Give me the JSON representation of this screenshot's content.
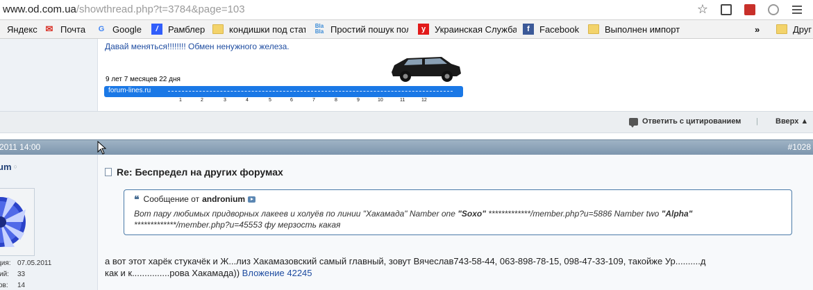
{
  "browser": {
    "url_host": "www.od.com.ua",
    "url_path": "/showthread.php?t=3784&page=103"
  },
  "bookmarks": [
    {
      "label": "Яндекс",
      "icon": "yandex-icon"
    },
    {
      "label": "Почта",
      "icon": "gmail-icon"
    },
    {
      "label": "Google",
      "icon": "google-icon"
    },
    {
      "label": "Рамблер",
      "icon": "rambler-icon"
    },
    {
      "label": "кондишки под стать",
      "icon": "folder-icon"
    },
    {
      "label": "Простий пошук пол",
      "icon": "blabla-icon"
    },
    {
      "label": "Украинская Служба",
      "icon": "y-icon"
    },
    {
      "label": "Facebook",
      "icon": "facebook-icon"
    },
    {
      "label": "Выполнен импорт",
      "icon": "folder-icon"
    },
    {
      "label": "»",
      "icon": "overflow-icon"
    },
    {
      "label": "Друг",
      "icon": "folder-icon"
    }
  ],
  "prev_post": {
    "signature_link": "Давай меняться!!!!!!!! Обмен ненужного железа.",
    "banner_age": "9 лет 7 месяцев 22 дня",
    "banner_label": "forum-lines.ru",
    "banner_scale": [
      "1",
      "2",
      "3",
      "4",
      "5",
      "6",
      "7",
      "8",
      "9",
      "10",
      "11",
      "12"
    ],
    "reply_quote": "Ответить с цитированием",
    "separator": "|",
    "top_link": "Вверх ▲"
  },
  "post": {
    "date": "2011 14:00",
    "number": "#1028",
    "username": "um",
    "online_status": "○",
    "title": "Re: Беспредел на других форумах",
    "quote_prefix": "Сообщение от",
    "quote_author": "andronium",
    "quote_text_1": "Вот пару любимых придворных лакеев и холуёв по линии \"Хакамада\" Namber one ",
    "quote_name_1": "\"Soxo\"",
    "quote_text_2": " *************/member.php?u=5886 Namber two ",
    "quote_name_2": "\"Alpha\"",
    "quote_text_3": " *************/member.php?u=45553 фу мерзость какая",
    "body_line1": "а вот этот харёк стукачёк и Ж...лиз Хакамазовский самый главный, зовут Вячеслав743-58-44, 063-898-78-15, 098-47-33-109, такойже Ур..........д",
    "body_line2_text": "как и к...............рова Хакамада)) ",
    "attachment": "Вложение 42245"
  },
  "user_stats": [
    {
      "label": "ция:",
      "value": "07.05.2011"
    },
    {
      "label": "ий:",
      "value": "33"
    },
    {
      "label": "ов:",
      "value": "14"
    }
  ]
}
